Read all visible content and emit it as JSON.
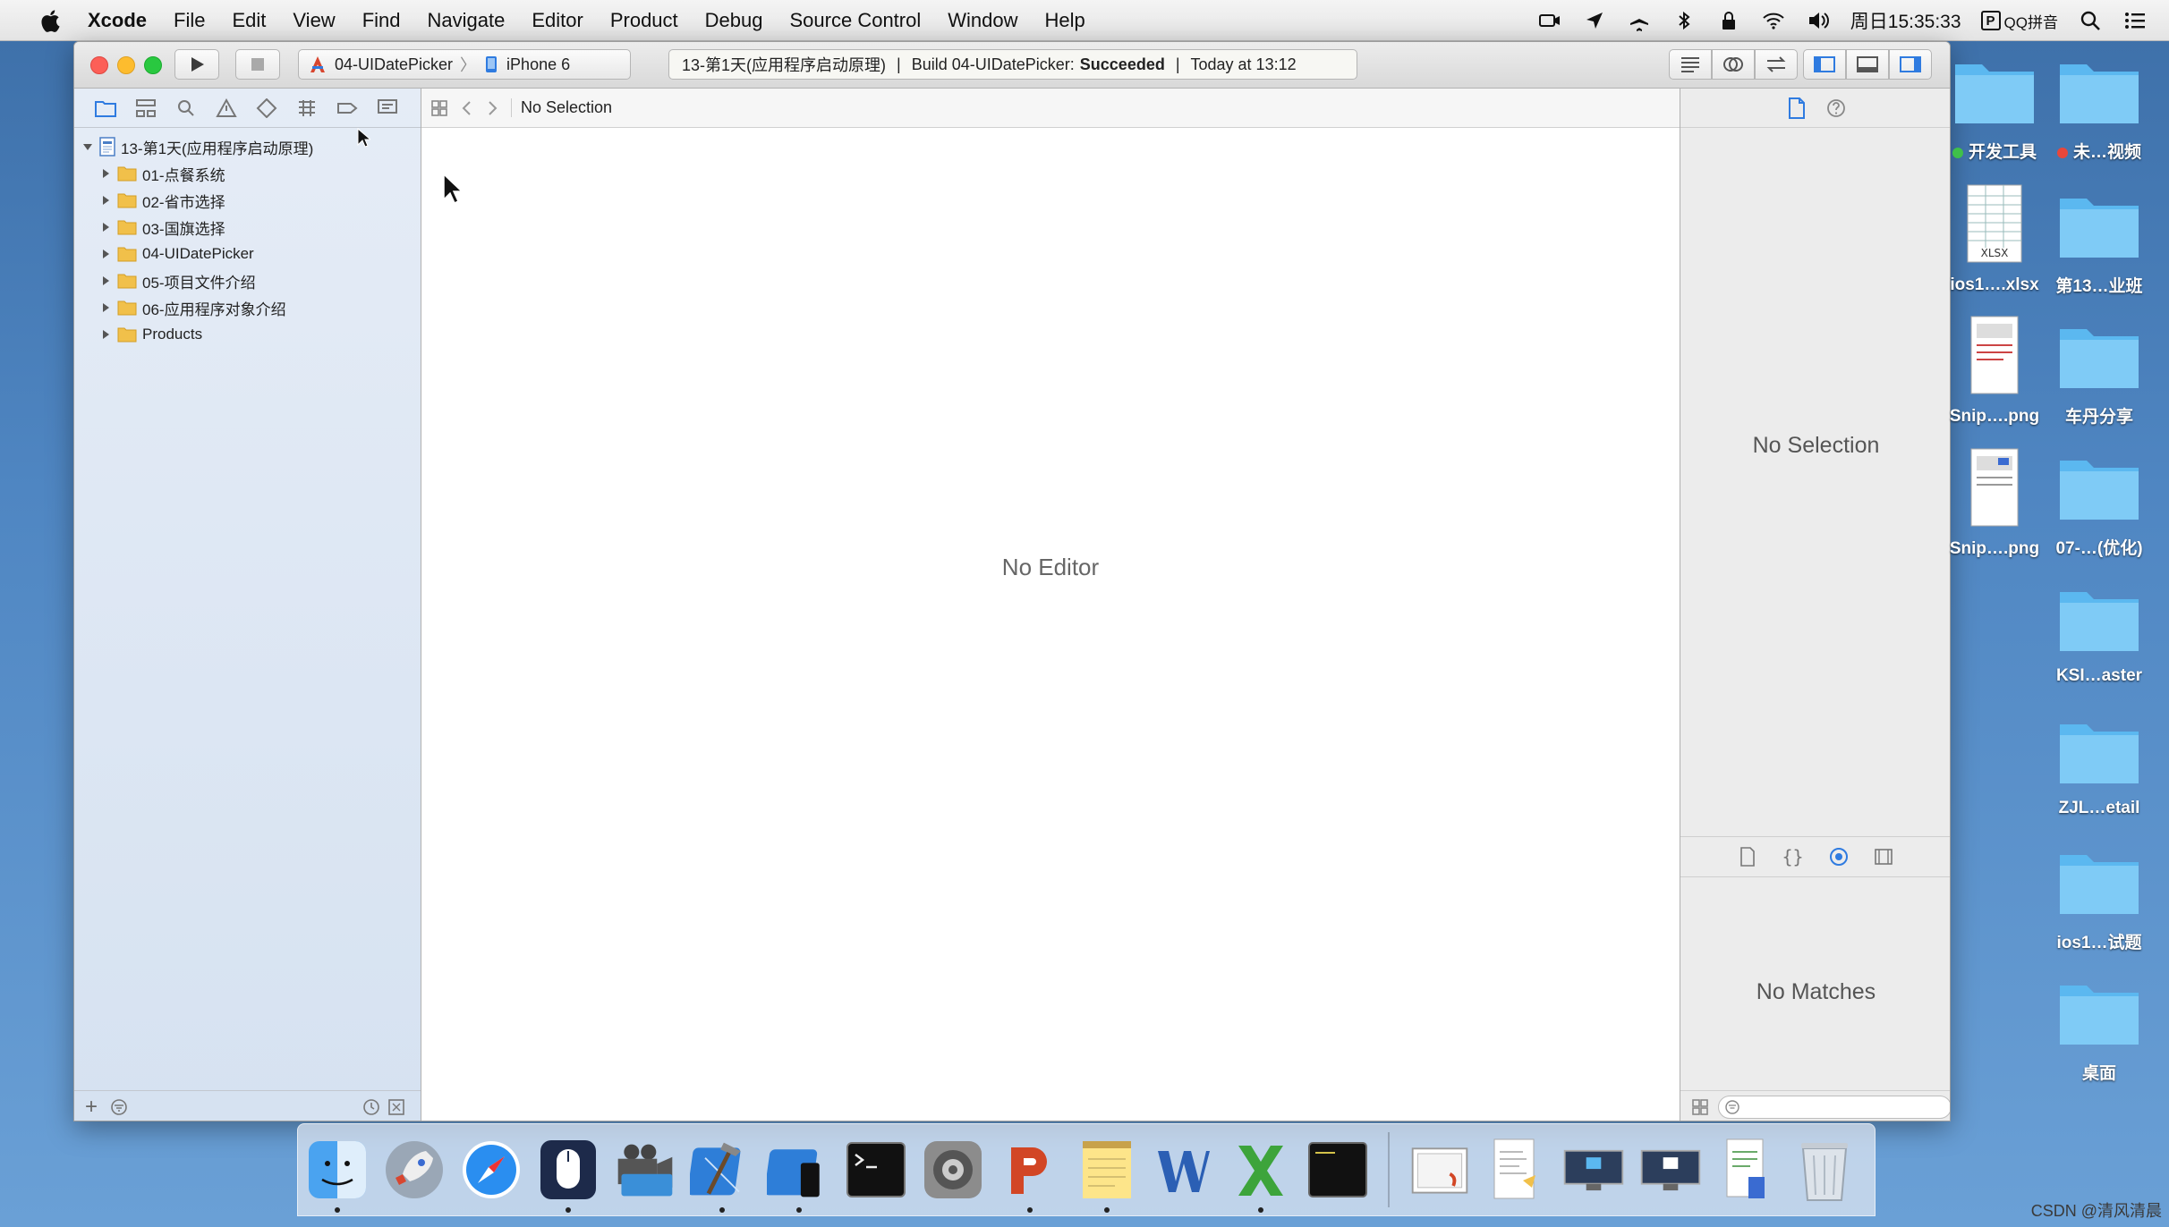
{
  "menubar": {
    "app_name": "Xcode",
    "items": [
      "File",
      "Edit",
      "View",
      "Find",
      "Navigate",
      "Editor",
      "Product",
      "Debug",
      "Source Control",
      "Window",
      "Help"
    ],
    "clock": "周日15:35:33",
    "input_method": "QQ拼音"
  },
  "toolbar": {
    "scheme_name": "04-UIDatePicker",
    "device_name": "iPhone 6",
    "activity_project": "13-第1天(应用程序启动原理)",
    "activity_build_prefix": "Build 04-UIDatePicker:",
    "activity_build_status": "Succeeded",
    "activity_time": "Today at 13:12"
  },
  "navigator": {
    "project_name": "13-第1天(应用程序启动原理)",
    "groups": [
      {
        "label": "01-点餐系统"
      },
      {
        "label": "02-省市选择"
      },
      {
        "label": "03-国旗选择"
      },
      {
        "label": "04-UIDatePicker"
      },
      {
        "label": "05-项目文件介绍"
      },
      {
        "label": "06-应用程序对象介绍"
      },
      {
        "label": "Products"
      }
    ]
  },
  "editor": {
    "jumpbar_text": "No Selection",
    "empty_text": "No Editor"
  },
  "inspector": {
    "no_selection_text": "No Selection",
    "no_matches_text": "No Matches"
  },
  "desktop": {
    "items": [
      {
        "label": "开发工具",
        "tag_color": "#3fc04a"
      },
      {
        "label": "未…视频",
        "tag_color": "#e8473b"
      },
      {
        "label": "ios1….xlsx",
        "badge": "XLSX"
      },
      {
        "label": "第13…业班"
      },
      {
        "label": "Snip….png"
      },
      {
        "label": "车丹分享"
      },
      {
        "label": "Snip….png"
      },
      {
        "label": "07-…(优化)"
      },
      {
        "label": "KSI…aster"
      },
      {
        "label": "ZJL…etail"
      },
      {
        "label": "ios1…试题"
      },
      {
        "label": "桌面"
      }
    ]
  },
  "dock": {
    "apps": [
      "finder",
      "launchpad",
      "safari",
      "mouse",
      "imovie",
      "xcode",
      "instruments",
      "terminal",
      "system-preferences",
      "powerpoint",
      "notes",
      "word",
      "excel",
      "console",
      "preview",
      "textedit",
      "screens",
      "screens-2",
      "document",
      "trash"
    ]
  },
  "watermark": "CSDN @清风清晨",
  "colors": {
    "accent": "#2f7be0",
    "folder": "#f1c04a",
    "desktop_folder": "#5bb8f0"
  }
}
